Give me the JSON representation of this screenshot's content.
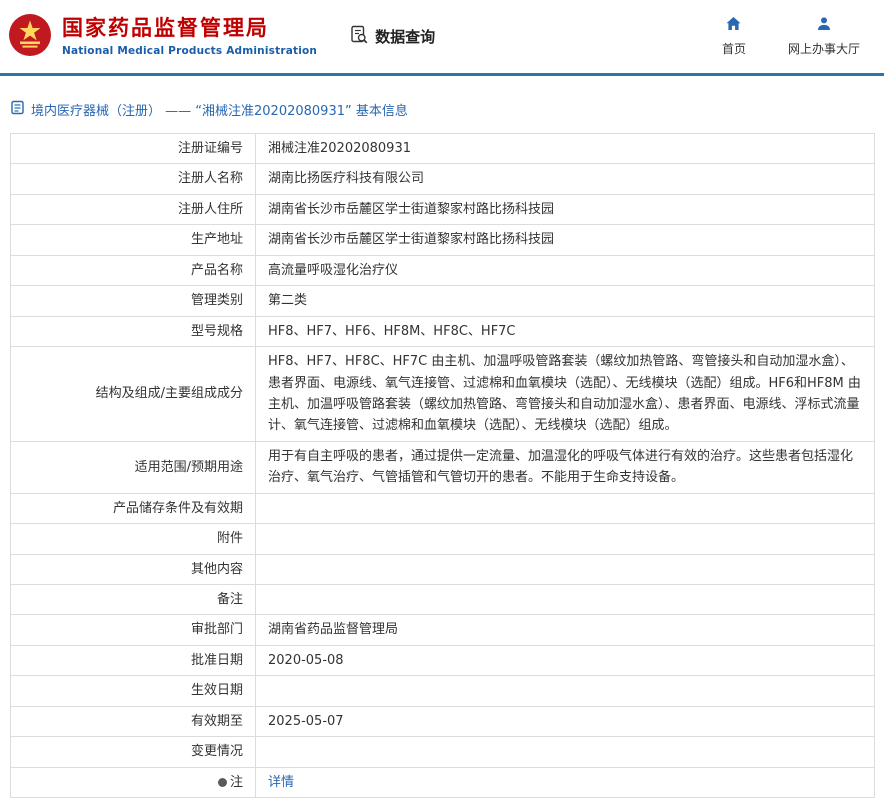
{
  "header": {
    "agency_cn": "国家药品监督管理局",
    "agency_en": "National Medical Products Administration",
    "data_query_label": "数据查询",
    "nav_home_label": "首页",
    "nav_hall_label": "网上办事大厅"
  },
  "colors": {
    "brand_red": "#c00000",
    "brand_blue": "#2867b2",
    "header_rule_blue": "#3173ad",
    "table_border": "#dcdcdc"
  },
  "page_title": "境内医疗器械（注册） ——  “湘械注准20202080931” 基本信息",
  "table": {
    "rows": [
      {
        "label": "注册证编号",
        "value": "湘械注准20202080931"
      },
      {
        "label": "注册人名称",
        "value": "湖南比扬医疗科技有限公司"
      },
      {
        "label": "注册人住所",
        "value": "湖南省长沙市岳麓区学士街道黎家村路比扬科技园"
      },
      {
        "label": "生产地址",
        "value": "湖南省长沙市岳麓区学士街道黎家村路比扬科技园"
      },
      {
        "label": "产品名称",
        "value": "高流量呼吸湿化治疗仪"
      },
      {
        "label": "管理类别",
        "value": "第二类"
      },
      {
        "label": "型号规格",
        "value": "HF8、HF7、HF6、HF8M、HF8C、HF7C"
      },
      {
        "label": "结构及组成/主要组成成分",
        "value": "HF8、HF7、HF8C、HF7C 由主机、加温呼吸管路套装（螺纹加热管路、弯管接头和自动加湿水盒）、患者界面、电源线、氧气连接管、过滤棉和血氧模块（选配）、无线模块（选配）组成。HF6和HF8M 由主机、加温呼吸管路套装（螺纹加热管路、弯管接头和自动加湿水盒）、患者界面、电源线、浮标式流量计、氧气连接管、过滤棉和血氧模块（选配）、无线模块（选配）组成。"
      },
      {
        "label": "适用范围/预期用途",
        "value": "用于有自主呼吸的患者，通过提供一定流量、加温湿化的呼吸气体进行有效的治疗。这些患者包括湿化治疗、氧气治疗、气管插管和气管切开的患者。不能用于生命支持设备。"
      },
      {
        "label": "产品储存条件及有效期",
        "value": ""
      },
      {
        "label": "附件",
        "value": ""
      },
      {
        "label": "其他内容",
        "value": ""
      },
      {
        "label": "备注",
        "value": ""
      },
      {
        "label": "审批部门",
        "value": "湖南省药品监督管理局"
      },
      {
        "label": "批准日期",
        "value": "2020-05-08"
      },
      {
        "label": "生效日期",
        "value": ""
      },
      {
        "label": "有效期至",
        "value": "2025-05-07"
      },
      {
        "label": "变更情况",
        "value": ""
      },
      {
        "label": "注",
        "value": "详情",
        "label_icon": true,
        "value_is_link": true
      }
    ]
  }
}
